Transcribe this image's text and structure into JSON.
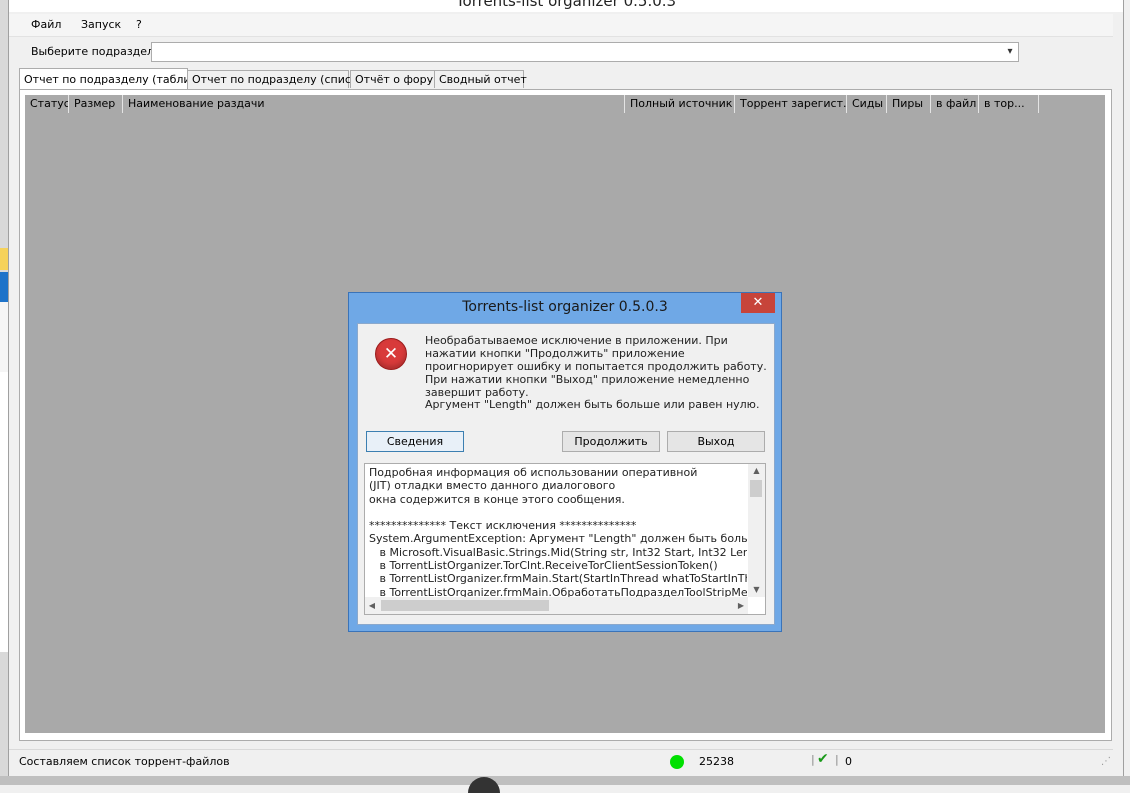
{
  "window": {
    "title": "Torrents-list organizer 0.5.0.3"
  },
  "menu": {
    "items": [
      "Файл",
      "Запуск",
      "?"
    ]
  },
  "subsection": {
    "label": "Выберите подраздел:",
    "value": ""
  },
  "tabs": [
    {
      "label": "Отчет по подразделу (таблица)",
      "active": true
    },
    {
      "label": "Отчет по подразделу (список)",
      "active": false
    },
    {
      "label": "Отчёт о форум",
      "active": false
    },
    {
      "label": "Сводный отчет",
      "active": false
    }
  ],
  "grid": {
    "columns": [
      "Статус",
      "Размер",
      "Наименование раздачи",
      "Полный источник",
      "Торрент зарегист.",
      "Сиды",
      "Пиры",
      "в файл",
      "в тор..."
    ]
  },
  "status": {
    "text": "Составляем список торрент-файлов",
    "count": "25238",
    "check_icon": "check-icon",
    "zero": "0",
    "dot_color": "#00e000"
  },
  "dialog": {
    "title": "Torrents-list organizer 0.5.0.3",
    "close_glyph": "✕",
    "icon": "error-icon",
    "message": "Необрабатываемое исключение в приложении. При нажатии кнопки \"Продолжить\" приложение проигнорирует ошибку и попытается продолжить работу. При нажатии кнопки \"Выход\" приложение немедленно завершит работу.",
    "argument": "Аргумент \"Length\" должен быть больше или равен нулю.",
    "buttons": {
      "details": "Сведения",
      "continue": "Продолжить",
      "exit": "Выход"
    },
    "details_text": "Подробная информация об использовании оперативной\n(JIT) отладки вместо данного диалогового\nокна содержится в конце этого сообщения.\n\n************** Текст исключения **************\nSystem.ArgumentException: Аргумент \"Length\" должен быть больше или ра\n   в Microsoft.VisualBasic.Strings.Mid(String str, Int32 Start, Int32 Length)\n   в TorrentListOrganizer.TorClnt.ReceiveTorClientSessionToken()\n   в TorrentListOrganizer.frmMain.Start(StartInThread whatToStartInThread, Boo\n   в TorrentListOrganizer.frmMain.ОбработатьПодразделToolStripMenuItem_C"
  }
}
